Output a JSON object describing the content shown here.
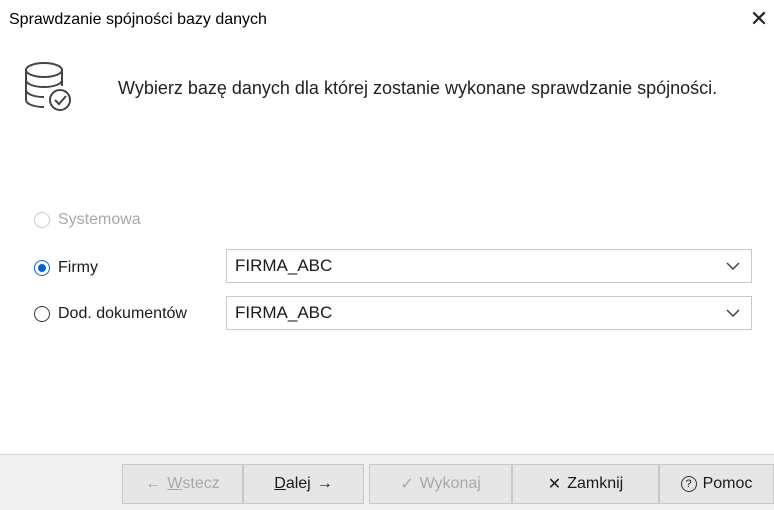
{
  "window": {
    "title": "Sprawdzanie spójności bazy danych",
    "close_icon": "close-icon"
  },
  "header": {
    "icon": "database-check-icon",
    "description": "Wybierz bazę danych dla której zostanie wykonane sprawdzanie spójności."
  },
  "options": [
    {
      "label": "Systemowa",
      "selected": false,
      "enabled": false
    },
    {
      "label": "Firmy",
      "selected": true,
      "enabled": true,
      "value": "FIRMA_ABC"
    },
    {
      "label": "Dod. dokumentów",
      "selected": false,
      "enabled": true,
      "value": "FIRMA_ABC"
    }
  ],
  "footer": {
    "back": {
      "arrow": "←",
      "u": "W",
      "rest": "stecz",
      "enabled": false
    },
    "next": {
      "u": "D",
      "rest": "alej",
      "arrow": "→",
      "enabled": true
    },
    "execute": {
      "check": "✓",
      "label": "Wykonaj",
      "enabled": false
    },
    "close": {
      "x": "✕",
      "label": "Zamknij",
      "enabled": true
    },
    "help": {
      "glyph": "?",
      "label": "Pomoc",
      "enabled": true
    }
  },
  "colors": {
    "accent": "#0a63c9",
    "disabled_text": "#a8a8a8",
    "footer_bg": "#f0f0f0"
  }
}
